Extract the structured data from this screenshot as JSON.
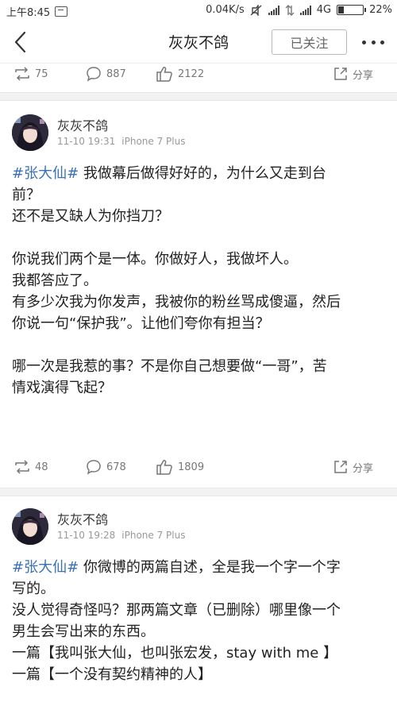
{
  "status_bar": {
    "time": "上午8:45",
    "net_speed": "0.04K/s",
    "network": "4G",
    "battery": "22%"
  },
  "nav": {
    "title": "灰灰不鸽",
    "follow_label": "已关注"
  },
  "top_actions": {
    "repost_count": "75",
    "comment_count": "887",
    "like_count": "2122",
    "share_label": "分享"
  },
  "posts": [
    {
      "username": "灰灰不鸽",
      "time": "11-10 19:31",
      "device": "iPhone 7 Plus",
      "hashtag": "#张大仙#",
      "lines": [
        " 我做幕后做得好好的，为什么又走到台\n前？",
        "还不是又缺人为你挡刀？",
        "",
        "你说我们两个是一体。你做好人，我做坏人。",
        "我都答应了。",
        "有多少次我为你发声，我被你的粉丝骂成傻逼，然后\n你说一句“保护我”。让他们夸你有担当？",
        "",
        "哪一次是我惹的事？不是你自己想要做“一哥”，苦\n情戏演得飞起？"
      ],
      "repost_count": "48",
      "comment_count": "678",
      "like_count": "1809",
      "share_label": "分享"
    },
    {
      "username": "灰灰不鸽",
      "time": "11-10 19:28",
      "device": "iPhone 7 Plus",
      "hashtag": "#张大仙#",
      "lines": [
        " 你微博的两篇自述，全是我一个字一个字\n写的。",
        "没人觉得奇怪吗？那两篇文章（已删除）哪里像一个\n男生会写出来的东西。",
        "一篇【我叫张大仙，也叫张宏发，stay with me 】",
        "一篇【一个没有契约精神的人】"
      ]
    }
  ],
  "colors": {
    "hashtag": "#3a70b5",
    "divider": "#f2f2f2"
  }
}
